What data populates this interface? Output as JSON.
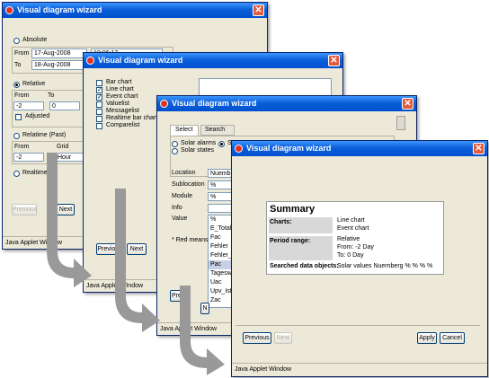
{
  "window_title": "Visual diagram wizard",
  "status_text": "Java Applet Window",
  "win1": {
    "absolute_label": "Absolute",
    "from_label": "From",
    "from_date": "17-Aug-2008",
    "from_time": "10:06:17",
    "to_label": "To",
    "to_date": "18-Aug-2008",
    "relative_label": "Relative",
    "rel_from_label": "From",
    "rel_to_label": "To",
    "rel_from_value": "-2",
    "rel_to_value": "0",
    "adjusted_label": "Adjusted",
    "realtime_past_label": "Relatime (Past)",
    "rt_from_label": "From",
    "rt_grid_label": "Grid",
    "rt_from_value": "-2",
    "rt_grid_value": "Hour",
    "realtime_label": "Realtime",
    "previous_label": "Previous",
    "next_label": "Next"
  },
  "win2": {
    "chart_types": [
      {
        "label": "Bar chart",
        "checked": false
      },
      {
        "label": "Line chart",
        "checked": true
      },
      {
        "label": "Event chart",
        "checked": true
      },
      {
        "label": "Valuelist",
        "checked": false
      },
      {
        "label": "Messagelist",
        "checked": false
      },
      {
        "label": "Realtime bar chart",
        "checked": false
      },
      {
        "label": "Comparelist",
        "checked": false
      }
    ],
    "previous_label": "Previous",
    "next_label": "Next"
  },
  "win3": {
    "tab_select": "Select",
    "tab_search": "Search",
    "radio_solar_alarms": "Solar alarms",
    "radio_solar_values": "S",
    "radio_solar_states": "Solar states",
    "location_label": "Location",
    "location_value": "Nuembe",
    "sublocation_label": "Sublocation",
    "sublocation_value": "%",
    "module_label": "Module",
    "module_value": "%",
    "info_label": "Info",
    "value_label": "Value",
    "value_options": [
      "%",
      "E_Total",
      "Fac",
      "Fehler",
      "Fehler_",
      "Pac",
      "Tagesw",
      "Uac",
      "Upv_Ist",
      "Zac"
    ],
    "selected_option": "Pac",
    "footnote": "* Red means",
    "previous_label": "Previ",
    "next_label": "N"
  },
  "win4": {
    "summary_title": "Summary",
    "charts_label": "Charts:",
    "charts_values": [
      "Line chart",
      "Event chart"
    ],
    "period_label": "Period range:",
    "period_values": [
      "Relative",
      "From: -2 Day",
      "To: 0 Day"
    ],
    "searched_label": "Searched data objects:",
    "searched_value": "Solar values Nuernberg % % % %",
    "previous_label": "Previous",
    "next_label": "Next",
    "apply_label": "Apply",
    "cancel_label": "Cancel"
  },
  "colors": {
    "titlebar": "#0a5fd8",
    "window_bg": "#ece9d8",
    "arrow": "#999999",
    "selected_item": "#c8d0e8"
  }
}
